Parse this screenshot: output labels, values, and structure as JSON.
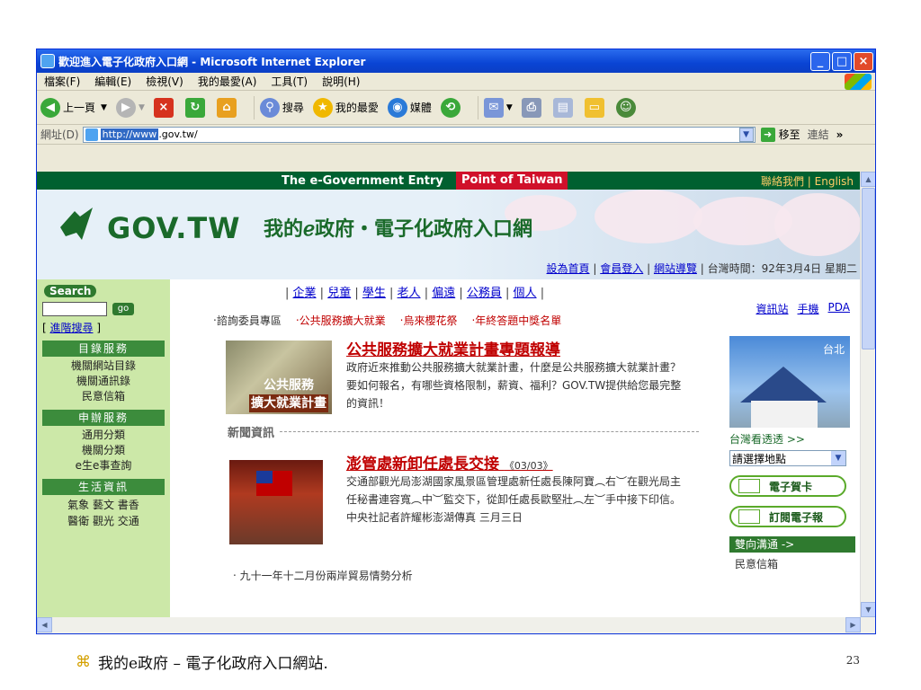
{
  "window": {
    "title": "歡迎進入電子化政府入口網 - Microsoft Internet Explorer",
    "controls": [
      "_",
      "□",
      "×"
    ]
  },
  "menu": [
    "檔案(F)",
    "編輯(E)",
    "檢視(V)",
    "我的最愛(A)",
    "工具(T)",
    "說明(H)"
  ],
  "toolbar": {
    "back_label": "上一頁",
    "search_label": "搜尋",
    "favorites_label": "我的最愛",
    "media_label": "媒體"
  },
  "address": {
    "label": "網址(D)",
    "url_selected": "http://www",
    "url_rest": ".gov.tw/",
    "go_label": "移至",
    "links_label": "連結",
    "more": "»"
  },
  "page": {
    "strip_main": "The e-Government Entry",
    "strip_point": "Point of Taiwan",
    "strip_contact": "聯絡我們 | English",
    "logo_text": "GOV.TW",
    "slogan": "我的ℯ政府・電子化政府入口網",
    "banner_links": {
      "home": "設為首頁",
      "member": "會員登入",
      "sitemap": "網站導覽",
      "time": "台灣時間：92年3月4日 星期二"
    },
    "left": {
      "search_title": "Search",
      "go": "go",
      "adv_open": "[ ",
      "adv_search": "進階搜尋",
      "adv_close": " ]",
      "sec1": "目錄服務",
      "sec1_items": [
        "機關網站目錄",
        "機關通訊錄",
        "民意信箱"
      ],
      "sec2": "申辦服務",
      "sec2_items": [
        "通用分類",
        "機關分類",
        "e生e事查詢"
      ],
      "sec3": "生活資訊",
      "sec3_rows": [
        "氣象 藝文 書香",
        "醫衛 觀光 交通"
      ]
    },
    "main": {
      "categories": [
        "企業",
        "兒童",
        "學生",
        "老人",
        "偏遠",
        "公務員",
        "個人"
      ],
      "quick_links": [
        "‧諮詢委員專區",
        "‧公共服務擴大就業",
        "‧烏來櫻花祭",
        "‧年終答題中獎名單"
      ],
      "story1": {
        "image_caption_1": "公共服務",
        "image_caption_2": "擴大就業計畫",
        "title": "公共服務擴大就業計畫專題報導",
        "body": "政府近來推動公共服務擴大就業計畫，什麼是公共服務擴大就業計畫？要如何報名，有哪些資格限制，薪資、福利？GOV.TW提供給您最完整的資訊！"
      },
      "news_head": "新聞資訊",
      "story2": {
        "title": "澎管處新卸任處長交接",
        "date": "《03/03》",
        "body": "交通部觀光局澎湖國家風景區管理處新任處長陳阿寶︵右︶在觀光局主任秘書連容寬︵中︶監交下，從卸任處長歐堅壯︵左︶手中接下印信。中央社記者許耀彬澎湖傳真 三月三日"
      },
      "bullet": "‧ 九十一年十二月份兩岸貿易情勢分析"
    },
    "right": {
      "links": [
        "資訊站",
        "手機",
        "PDA"
      ],
      "photo_label": "台北",
      "tour_title": "台灣看透透 >>",
      "tour_select": "請選擇地點",
      "ecard": "電子賀卡",
      "epaper": "訂閱電子報",
      "dialog_head": "雙向溝通 ->",
      "mailbox": "民意信箱"
    }
  },
  "slide": {
    "symbol": "⌘",
    "caption": "我的e政府 – 電子化政府入口網站.",
    "page_number": "23"
  },
  "colors": {
    "titlebar": "#0a44d4",
    "strip": "#006030",
    "point": "#d0102a",
    "left_panel": "#cce8a8",
    "story_red": "#c00000"
  }
}
